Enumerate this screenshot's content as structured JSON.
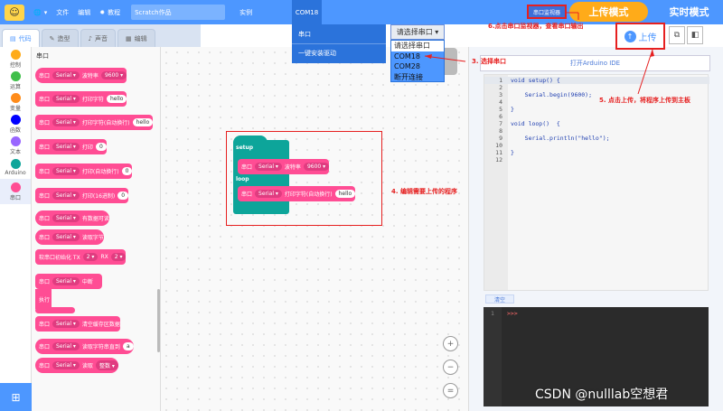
{
  "topbar": {
    "logo": "☺",
    "menu_file": "文件",
    "menu_edit": "编辑",
    "menu_tutorial": "教程",
    "project_title": "Scratch作品",
    "menu_examples": "实例",
    "com_label": "COM18",
    "monitor_label": "串口监视器",
    "upload_mode": "上传模式",
    "realtime_mode": "实时模式"
  },
  "com_dropdown": {
    "items": [
      "串口",
      "一键安装驱动"
    ]
  },
  "port_select": {
    "selected": "请选择串口 ▾",
    "options": [
      "请选择串口",
      "COM18",
      "COM28",
      "断开连接"
    ]
  },
  "tabs": [
    {
      "label": "代码",
      "icon": "code-icon"
    },
    {
      "label": "造型",
      "icon": "costume-icon"
    },
    {
      "label": "声音",
      "icon": "sound-icon"
    },
    {
      "label": "编辑",
      "icon": "edit-icon"
    }
  ],
  "categories": [
    {
      "label": "控制",
      "color": "#ffab19"
    },
    {
      "label": "运算",
      "color": "#40bf4a"
    },
    {
      "label": "变量",
      "color": "#ff8c1a"
    },
    {
      "label": "函数",
      "color": "#0000ff"
    },
    {
      "label": "文本",
      "color": "#9966ff"
    },
    {
      "label": "Arduino",
      "color": "#0da59a"
    },
    {
      "label": "串口",
      "color": "#ff4d94"
    }
  ],
  "palette": {
    "title": "串口",
    "blocks": [
      {
        "parts": [
          "串口",
          "Serial ▾",
          "波特率",
          "9600 ▾"
        ]
      },
      {
        "parts": [
          "串口",
          "Serial ▾",
          "打印字符",
          "hello"
        ]
      },
      {
        "parts": [
          "串口",
          "Serial ▾",
          "打印字符(自动换行)",
          "hello"
        ]
      },
      {
        "parts": [
          "串口",
          "Serial ▾",
          "打印",
          "0"
        ]
      },
      {
        "parts": [
          "串口",
          "Serial ▾",
          "打印(自动换行)",
          "0"
        ]
      },
      {
        "parts": [
          "串口",
          "Serial ▾",
          "打印(16进制)",
          "0"
        ]
      },
      {
        "parts": [
          "串口",
          "Serial ▾",
          "有数据可读"
        ]
      },
      {
        "parts": [
          "串口",
          "Serial ▾",
          "读取字节"
        ]
      },
      {
        "parts": [
          "软串口初始化 TX",
          "2 ▾",
          "RX",
          "2 ▾"
        ]
      },
      {
        "parts": [
          "串口",
          "Serial ▾",
          "中断"
        ]
      },
      {
        "parts": [
          "执行"
        ]
      },
      {
        "parts": [
          "串口",
          "Serial ▾",
          "清空缓存区数据"
        ]
      },
      {
        "parts": [
          "串口",
          "Serial ▾",
          "读取字符串直到",
          "a"
        ]
      },
      {
        "parts": [
          "串口",
          "Serial ▾",
          "读取",
          "整数 ▾"
        ]
      }
    ]
  },
  "workspace": {
    "setup_label": "setup",
    "loop_label": "loop",
    "setup_block": [
      "串口",
      "Serial ▾",
      "波特率",
      "9600 ▾"
    ],
    "loop_block": [
      "串口",
      "Serial ▾",
      "打印字符(自动换行)",
      "hello"
    ],
    "zoom_in": "+",
    "zoom_out": "−",
    "zoom_reset": "="
  },
  "right_panel": {
    "open_ide": "打开Arduino IDE",
    "upload_label": "上传",
    "clear_label": "清空",
    "code_lines": [
      "void setup() {",
      "",
      "    Serial.begin(9600);",
      "",
      "}",
      "",
      "void loop()  {",
      "",
      "    Serial.println(\"hello\");",
      "",
      "}",
      ""
    ],
    "console_line": "1",
    "console_prompt": ">>>"
  },
  "annotations": {
    "a3": "3. 选择串口",
    "a4": "4. 编辑需要上传的程序",
    "a5": "5. 点击上传，将程序上传到主板",
    "a6": "6.点击串口监视器，查看串口输出"
  },
  "watermark": "CSDN @nulllab空想君",
  "colors": {
    "accent": "#4d97ff",
    "block": "#ff4d94",
    "arduino": "#0da59a",
    "annotation": "#e62020",
    "mode": "#ffab19"
  }
}
